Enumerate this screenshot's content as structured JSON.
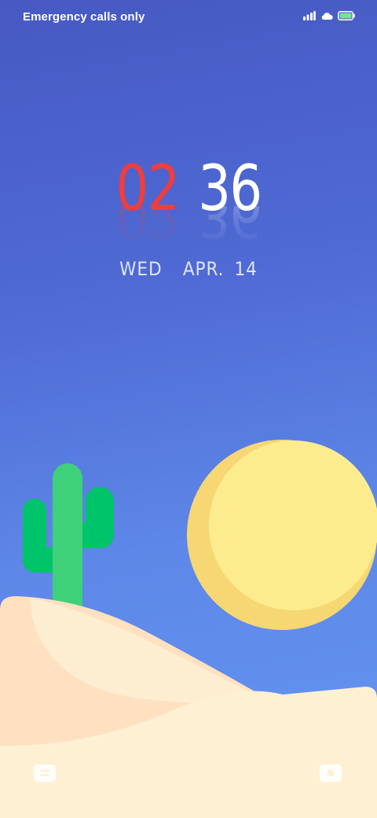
{
  "status_bar": {
    "carrier_text": "Emergency calls only",
    "icons": [
      "signal-icon",
      "cloud-icon",
      "battery-icon"
    ]
  },
  "clock": {
    "hour": "02",
    "minute": "36"
  },
  "date": {
    "text": "WED  APR. 14"
  },
  "wallpaper": {
    "theme": "desert",
    "colors": {
      "sky_top": "#4759c3",
      "sky_bottom": "#6596f2",
      "sun": "#fdeb8a",
      "sun_shadow": "#f5d66f",
      "cactus": "#3fd07a",
      "cactus_dark": "#00c46a",
      "sand_light": "#fef0d3",
      "sand_dark": "#ffe0c2",
      "hour_color": "#f13d3d"
    }
  },
  "bottom_bar": {
    "left_icon": "notes-icon",
    "right_icon": "camera-icon"
  }
}
